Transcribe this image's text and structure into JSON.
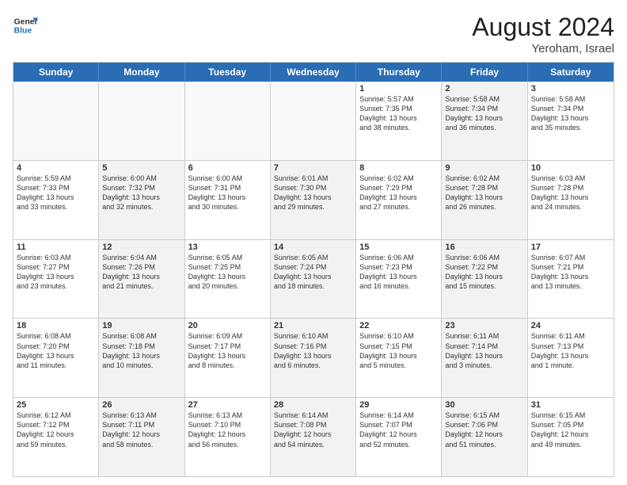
{
  "header": {
    "logo_line1": "General",
    "logo_line2": "Blue",
    "month_year": "August 2024",
    "location": "Yeroham, Israel"
  },
  "days_of_week": [
    "Sunday",
    "Monday",
    "Tuesday",
    "Wednesday",
    "Thursday",
    "Friday",
    "Saturday"
  ],
  "rows": [
    [
      {
        "day": "",
        "text": "",
        "empty": true
      },
      {
        "day": "",
        "text": "",
        "empty": true
      },
      {
        "day": "",
        "text": "",
        "empty": true
      },
      {
        "day": "",
        "text": "",
        "empty": true
      },
      {
        "day": "1",
        "text": "Sunrise: 5:57 AM\nSunset: 7:35 PM\nDaylight: 13 hours\nand 38 minutes.",
        "empty": false,
        "shaded": false
      },
      {
        "day": "2",
        "text": "Sunrise: 5:58 AM\nSunset: 7:34 PM\nDaylight: 13 hours\nand 36 minutes.",
        "empty": false,
        "shaded": true
      },
      {
        "day": "3",
        "text": "Sunrise: 5:58 AM\nSunset: 7:34 PM\nDaylight: 13 hours\nand 35 minutes.",
        "empty": false,
        "shaded": false
      }
    ],
    [
      {
        "day": "4",
        "text": "Sunrise: 5:59 AM\nSunset: 7:33 PM\nDaylight: 13 hours\nand 33 minutes.",
        "empty": false,
        "shaded": false
      },
      {
        "day": "5",
        "text": "Sunrise: 6:00 AM\nSunset: 7:32 PM\nDaylight: 13 hours\nand 32 minutes.",
        "empty": false,
        "shaded": true
      },
      {
        "day": "6",
        "text": "Sunrise: 6:00 AM\nSunset: 7:31 PM\nDaylight: 13 hours\nand 30 minutes.",
        "empty": false,
        "shaded": false
      },
      {
        "day": "7",
        "text": "Sunrise: 6:01 AM\nSunset: 7:30 PM\nDaylight: 13 hours\nand 29 minutes.",
        "empty": false,
        "shaded": true
      },
      {
        "day": "8",
        "text": "Sunrise: 6:02 AM\nSunset: 7:29 PM\nDaylight: 13 hours\nand 27 minutes.",
        "empty": false,
        "shaded": false
      },
      {
        "day": "9",
        "text": "Sunrise: 6:02 AM\nSunset: 7:28 PM\nDaylight: 13 hours\nand 26 minutes.",
        "empty": false,
        "shaded": true
      },
      {
        "day": "10",
        "text": "Sunrise: 6:03 AM\nSunset: 7:28 PM\nDaylight: 13 hours\nand 24 minutes.",
        "empty": false,
        "shaded": false
      }
    ],
    [
      {
        "day": "11",
        "text": "Sunrise: 6:03 AM\nSunset: 7:27 PM\nDaylight: 13 hours\nand 23 minutes.",
        "empty": false,
        "shaded": false
      },
      {
        "day": "12",
        "text": "Sunrise: 6:04 AM\nSunset: 7:26 PM\nDaylight: 13 hours\nand 21 minutes.",
        "empty": false,
        "shaded": true
      },
      {
        "day": "13",
        "text": "Sunrise: 6:05 AM\nSunset: 7:25 PM\nDaylight: 13 hours\nand 20 minutes.",
        "empty": false,
        "shaded": false
      },
      {
        "day": "14",
        "text": "Sunrise: 6:05 AM\nSunset: 7:24 PM\nDaylight: 13 hours\nand 18 minutes.",
        "empty": false,
        "shaded": true
      },
      {
        "day": "15",
        "text": "Sunrise: 6:06 AM\nSunset: 7:23 PM\nDaylight: 13 hours\nand 16 minutes.",
        "empty": false,
        "shaded": false
      },
      {
        "day": "16",
        "text": "Sunrise: 6:06 AM\nSunset: 7:22 PM\nDaylight: 13 hours\nand 15 minutes.",
        "empty": false,
        "shaded": true
      },
      {
        "day": "17",
        "text": "Sunrise: 6:07 AM\nSunset: 7:21 PM\nDaylight: 13 hours\nand 13 minutes.",
        "empty": false,
        "shaded": false
      }
    ],
    [
      {
        "day": "18",
        "text": "Sunrise: 6:08 AM\nSunset: 7:20 PM\nDaylight: 13 hours\nand 11 minutes.",
        "empty": false,
        "shaded": false
      },
      {
        "day": "19",
        "text": "Sunrise: 6:08 AM\nSunset: 7:18 PM\nDaylight: 13 hours\nand 10 minutes.",
        "empty": false,
        "shaded": true
      },
      {
        "day": "20",
        "text": "Sunrise: 6:09 AM\nSunset: 7:17 PM\nDaylight: 13 hours\nand 8 minutes.",
        "empty": false,
        "shaded": false
      },
      {
        "day": "21",
        "text": "Sunrise: 6:10 AM\nSunset: 7:16 PM\nDaylight: 13 hours\nand 6 minutes.",
        "empty": false,
        "shaded": true
      },
      {
        "day": "22",
        "text": "Sunrise: 6:10 AM\nSunset: 7:15 PM\nDaylight: 13 hours\nand 5 minutes.",
        "empty": false,
        "shaded": false
      },
      {
        "day": "23",
        "text": "Sunrise: 6:11 AM\nSunset: 7:14 PM\nDaylight: 13 hours\nand 3 minutes.",
        "empty": false,
        "shaded": true
      },
      {
        "day": "24",
        "text": "Sunrise: 6:11 AM\nSunset: 7:13 PM\nDaylight: 13 hours\nand 1 minute.",
        "empty": false,
        "shaded": false
      }
    ],
    [
      {
        "day": "25",
        "text": "Sunrise: 6:12 AM\nSunset: 7:12 PM\nDaylight: 12 hours\nand 59 minutes.",
        "empty": false,
        "shaded": false
      },
      {
        "day": "26",
        "text": "Sunrise: 6:13 AM\nSunset: 7:11 PM\nDaylight: 12 hours\nand 58 minutes.",
        "empty": false,
        "shaded": true
      },
      {
        "day": "27",
        "text": "Sunrise: 6:13 AM\nSunset: 7:10 PM\nDaylight: 12 hours\nand 56 minutes.",
        "empty": false,
        "shaded": false
      },
      {
        "day": "28",
        "text": "Sunrise: 6:14 AM\nSunset: 7:08 PM\nDaylight: 12 hours\nand 54 minutes.",
        "empty": false,
        "shaded": true
      },
      {
        "day": "29",
        "text": "Sunrise: 6:14 AM\nSunset: 7:07 PM\nDaylight: 12 hours\nand 52 minutes.",
        "empty": false,
        "shaded": false
      },
      {
        "day": "30",
        "text": "Sunrise: 6:15 AM\nSunset: 7:06 PM\nDaylight: 12 hours\nand 51 minutes.",
        "empty": false,
        "shaded": true
      },
      {
        "day": "31",
        "text": "Sunrise: 6:15 AM\nSunset: 7:05 PM\nDaylight: 12 hours\nand 49 minutes.",
        "empty": false,
        "shaded": false
      }
    ]
  ]
}
